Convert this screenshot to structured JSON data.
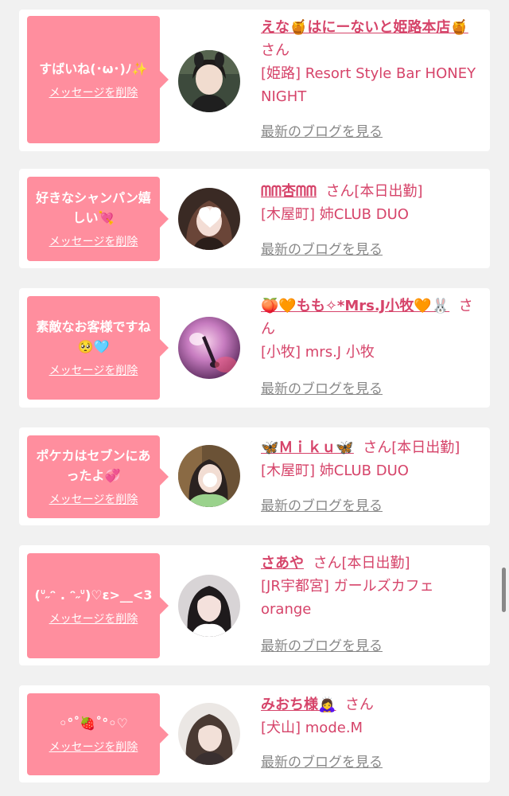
{
  "delete_label": "メッセージを削除",
  "blog_label": "最新のブログを見る",
  "san_label": "さん",
  "cards": [
    {
      "message": "すばいね(･ω･)ﾉ✨",
      "name": "えな🍯はにーないと姫路本店🍯",
      "suffix": "さん",
      "shop": "[姫路] Resort Style Bar HONEY NIGHT"
    },
    {
      "message": "好きなシャンパン嬉しい💘",
      "name": "ᗰᗰ杏ᗰᗰ",
      "suffix": "さん[本日出勤]",
      "shop": "[木屋町] 姉CLUB DUO"
    },
    {
      "message": "素敵なお客様ですね🥺🩵",
      "name": "🍑🧡もも✧*Mrs.J小牧🧡🐰",
      "suffix": "さん",
      "shop": "[小牧] mrs.J 小牧"
    },
    {
      "message": "ポケカはセブンにあったよ💞",
      "name": "🦋Ｍｉｋｕ🦋",
      "suffix": "さん[本日出勤]",
      "shop": "[木屋町] 姉CLUB DUO"
    },
    {
      "message": "(ᐡ˶ᵔ . ᵔ˶ᐡ)♡ε>__<3",
      "name": "さあや",
      "suffix": "さん[本日出勤]",
      "shop": "[JR宇都宮] ガールズカフェ orange"
    },
    {
      "message": "◦°˚🍓˚°◦♡",
      "name": "みおち様🙇‍♀️",
      "suffix": "さん",
      "shop": "[犬山] mode.M"
    }
  ],
  "colors": {
    "bubble": "#ff8e9e",
    "name": "#d6446a",
    "link": "#888888",
    "background": "#f1f1f1"
  }
}
